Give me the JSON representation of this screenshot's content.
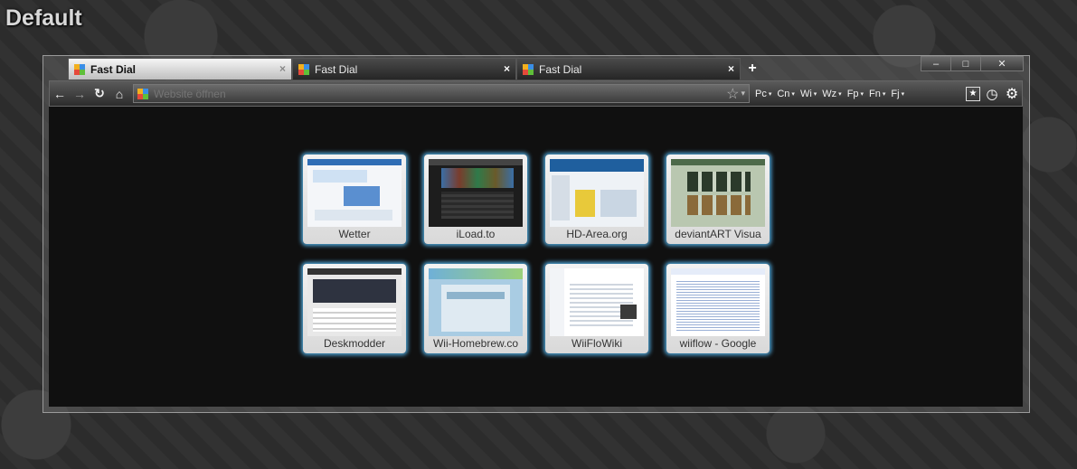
{
  "profile_label": "Default",
  "colors": {
    "accent_glow": "#4ea6d9",
    "content_bg": "#101010"
  },
  "tabs": [
    {
      "title": "Fast Dial",
      "active": true,
      "close_icon": "×"
    },
    {
      "title": "Fast Dial",
      "active": false,
      "close_icon": "×"
    },
    {
      "title": "Fast Dial",
      "active": false,
      "close_icon": "×"
    }
  ],
  "new_tab_icon": "+",
  "window_controls": {
    "minimize": "–",
    "maximize": "□",
    "close": "✕"
  },
  "toolbar": {
    "back_icon": "←",
    "forward_icon": "→",
    "reload_icon": "↻",
    "home_icon": "⌂",
    "address_placeholder": "Website öffnen",
    "star_icon": "☆",
    "dropdown_icon": "▾",
    "extensions": [
      "Pc",
      "Cn",
      "Wi",
      "Wz",
      "Fp",
      "Fn",
      "Fj"
    ],
    "bookmark_icon": "★",
    "history_icon": "◷",
    "settings_icon": "⚙"
  },
  "speed_dial": [
    {
      "label": "Wetter"
    },
    {
      "label": "iLoad.to"
    },
    {
      "label": "HD-Area.org"
    },
    {
      "label": "deviantART Visua"
    },
    {
      "label": "Deskmodder"
    },
    {
      "label": "Wii-Homebrew.co"
    },
    {
      "label": "WiiFloWiki"
    },
    {
      "label": "wiiflow - Google"
    }
  ]
}
